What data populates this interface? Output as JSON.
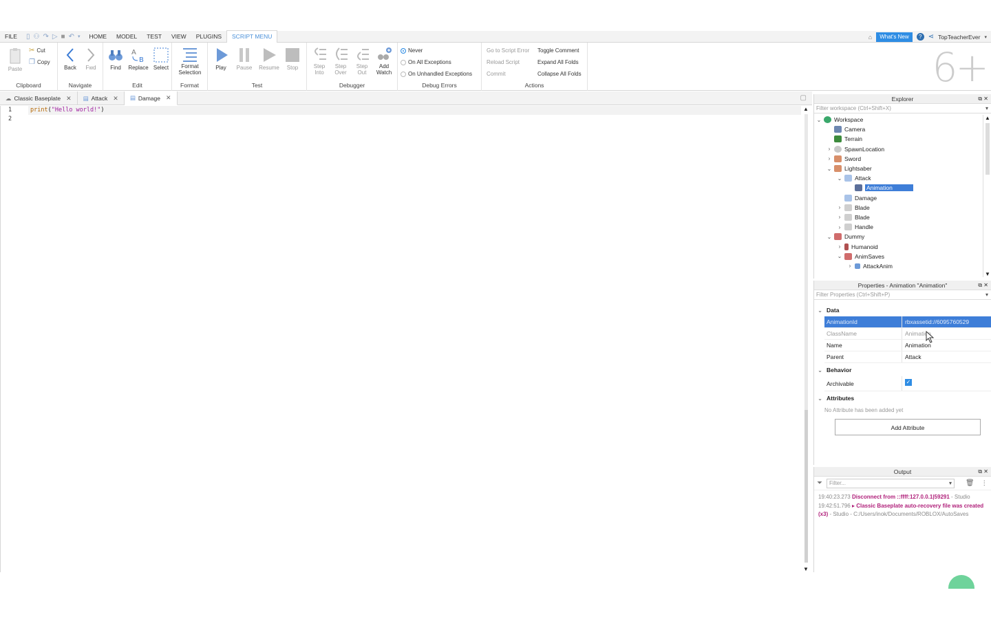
{
  "menubar": {
    "file": "FILE",
    "tabs": [
      "HOME",
      "MODEL",
      "TEST",
      "VIEW",
      "PLUGINS",
      "SCRIPT MENU"
    ],
    "whats_new": "What's New",
    "username": "TopTeacherEver"
  },
  "ribbon": {
    "clipboard": {
      "label": "Clipboard",
      "paste": "Paste",
      "cut": "Cut",
      "copy": "Copy"
    },
    "navigate": {
      "label": "Navigate",
      "back": "Back",
      "fwd": "Fwd"
    },
    "edit": {
      "label": "Edit",
      "find": "Find",
      "replace": "Replace",
      "select": "Select"
    },
    "format": {
      "label": "Format",
      "format_selection_1": "Format",
      "format_selection_2": "Selection"
    },
    "test": {
      "label": "Test",
      "play": "Play",
      "pause": "Pause",
      "resume": "Resume",
      "stop": "Stop"
    },
    "debugger": {
      "label": "Debugger",
      "step_into_1": "Step",
      "step_into_2": "Into",
      "step_over_1": "Step",
      "step_over_2": "Over",
      "step_out_1": "Step",
      "step_out_2": "Out",
      "add_watch_1": "Add",
      "add_watch_2": "Watch"
    },
    "debug_errors": {
      "label": "Debug Errors",
      "never": "Never",
      "all": "On All Exceptions",
      "unhandled": "On Unhandled Exceptions"
    },
    "actions": {
      "label": "Actions",
      "goto_error": "Go to Script Error",
      "reload": "Reload Script",
      "commit": "Commit",
      "toggle_comment": "Toggle Comment",
      "expand": "Expand All Folds",
      "collapse": "Collapse All Folds"
    },
    "big_overlay": "6+"
  },
  "doctabs": [
    "Classic Baseplate",
    "Attack",
    "Damage"
  ],
  "editor": {
    "line_numbers": [
      "1",
      "2"
    ],
    "code_fn": "print",
    "code_open": "(",
    "code_str": "\"Hello world!\"",
    "code_close": ")"
  },
  "explorer": {
    "title": "Explorer",
    "filter": "Filter workspace (Ctrl+Shift+X)",
    "items": [
      "Workspace",
      "Camera",
      "Terrain",
      "SpawnLocation",
      "Sword",
      "Lightsaber",
      "Attack",
      "Animation",
      "Damage",
      "Blade",
      "Blade",
      "Handle",
      "Dummy",
      "Humanoid",
      "AnimSaves",
      "AttackAnim"
    ]
  },
  "properties": {
    "title": "Properties - Animation \"Animation\"",
    "filter": "Filter Properties (Ctrl+Shift+P)",
    "groups": {
      "data": "Data",
      "behavior": "Behavior",
      "attributes": "Attributes"
    },
    "rows": [
      {
        "name": "AnimationId",
        "value": "rbxassetid://6095760529"
      },
      {
        "name": "ClassName",
        "value": "Animation"
      },
      {
        "name": "Name",
        "value": "Animation"
      },
      {
        "name": "Parent",
        "value": "Attack"
      }
    ],
    "archivable": "Archivable",
    "no_attr": "No Attribute has been added yet",
    "add_attr": "Add Attribute"
  },
  "output": {
    "title": "Output",
    "filter": "Filter...",
    "log": [
      {
        "ts": "19:40:23.273",
        "msg": "Disconnect from ::ffff:127.0.0.1|59291",
        "src": " - Studio"
      },
      {
        "ts": "19:42:51.796",
        "msg": "▸ Classic Baseplate auto-recovery file was created (x3)",
        "src": " - Studio - C:/Users/inok/Documents/ROBLOX/AutoSaves"
      }
    ]
  }
}
